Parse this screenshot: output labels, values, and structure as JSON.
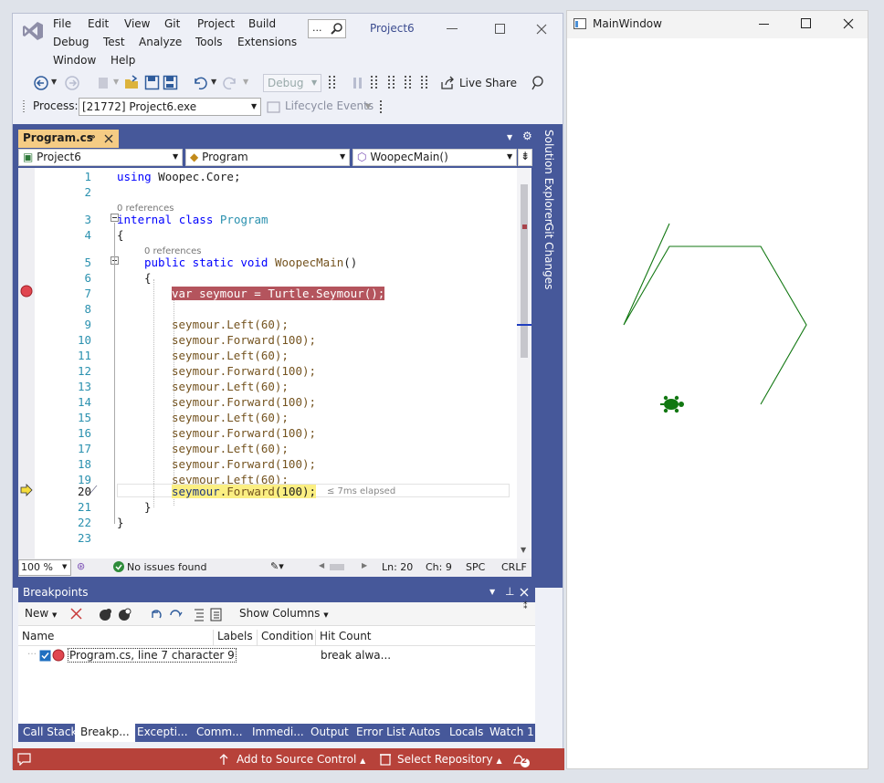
{
  "vs": {
    "menu": [
      "File",
      "Edit",
      "View",
      "Git",
      "Project",
      "Build",
      "Debug",
      "Test",
      "Analyze",
      "Tools",
      "Extensions",
      "Window",
      "Help"
    ],
    "search_label": "...",
    "project_title": "Project6",
    "config": "Debug",
    "live_share": "Live Share",
    "process_label": "Process:",
    "process_value": "[21772] Project6.exe",
    "lifecycle": "Lifecycle Events",
    "doc_tab": "Program.cs",
    "nav": {
      "project": "Project6",
      "type": "Program",
      "member": "WoopecMain()"
    },
    "side_tabs": [
      "Solution Explorer",
      "Git Changes"
    ],
    "code": {
      "line_numbers": [
        "1",
        "2",
        "3",
        "4",
        "5",
        "6",
        "7",
        "8",
        "9",
        "10",
        "11",
        "12",
        "13",
        "14",
        "15",
        "16",
        "17",
        "18",
        "19",
        "20",
        "21",
        "22",
        "23"
      ],
      "refs": "0 references",
      "using_kw": "using",
      "using_ns": "Woopec.Core;",
      "internal_kw": "internal class",
      "program": "Program",
      "brace_open": "{",
      "brace_close": "}",
      "public_kw": "public static void",
      "main": "WoopecMain",
      "paren": "()",
      "bp_line": "var seymour = Turtle.Seymour();",
      "calls": [
        "seymour.Left(60);",
        "seymour.Forward(100);",
        "seymour.Left(60);",
        "seymour.Forward(100);",
        "seymour.Left(60);",
        "seymour.Forward(100);",
        "seymour.Left(60);",
        "seymour.Forward(100);",
        "seymour.Left(60);",
        "seymour.Forward(100);",
        "seymour.Left(60);"
      ],
      "current": "seymour.Forward(100);",
      "elapsed": "≤ 7ms elapsed"
    },
    "status": {
      "zoom": "100 %",
      "issues": "No issues found",
      "ln": "Ln: 20",
      "ch": "Ch: 9",
      "spc": "SPC",
      "crlf": "CRLF"
    },
    "breakpoints": {
      "title": "Breakpoints",
      "new": "New",
      "show_columns": "Show Columns",
      "columns": [
        "Name",
        "Labels",
        "Condition",
        "Hit Count"
      ],
      "row": {
        "name": "Program.cs, line 7 character 9",
        "hit": "break alwa..."
      }
    },
    "bottom_tabs": [
      "Call Stack",
      "Breakp...",
      "Excepti...",
      "Comm...",
      "Immedi...",
      "Output",
      "Error List",
      "Autos",
      "Locals",
      "Watch 1"
    ],
    "statusbar": {
      "add_source": "Add to Source Control",
      "select_repo": "Select Repository",
      "notif": "2"
    }
  },
  "main_window": {
    "title": "MainWindow"
  },
  "colors": {
    "accent": "#46589a",
    "status": "#b7423a",
    "breakpoint": "#e04650",
    "turtle": "#117711"
  }
}
